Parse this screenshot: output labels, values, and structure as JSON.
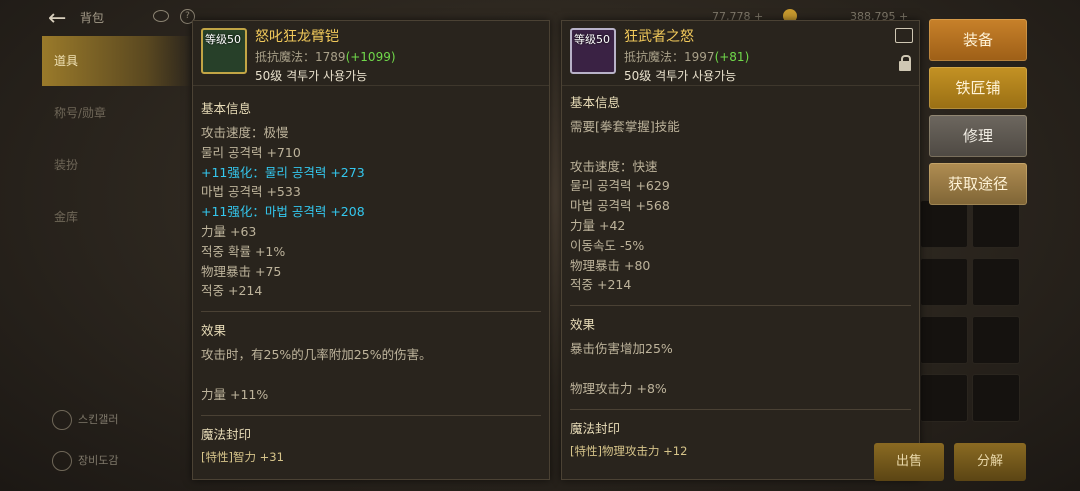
{
  "top": {
    "title": "背包",
    "currency_1": "77,778 +",
    "currency_2": "388,795 +"
  },
  "sidebar": {
    "items": [
      {
        "label": "道具"
      },
      {
        "label": "称号/勋章"
      },
      {
        "label": "装扮"
      },
      {
        "label": "金库"
      }
    ],
    "bottom_1": "스킨갤러",
    "bottom_2": "장비도감"
  },
  "left_item": {
    "level_badge": "等级50",
    "name": "怒叱狂龙臂铠",
    "magic_resist_label": "抵抗魔法：",
    "magic_resist_value": "1789",
    "magic_resist_bonus": "(+1099)",
    "requirement": "50级 격투가 사용가능",
    "basic_info_title": "基本信息",
    "stats": [
      "攻击速度：极慢",
      "물리 공격력 +710",
      "+11强化：물리 공격력 +273",
      "마법 공격력 +533",
      "+11强化：마법 공격력 +208",
      "力量 +63",
      "적중 확률 +1%",
      "物理暴击 +75",
      "적중 +214"
    ],
    "effect_title": "效果",
    "effect_lines": [
      "攻击时，有25%的几率附加25%的伤害。",
      "",
      "力量 +11%"
    ],
    "seal_title": "魔法封印",
    "seal_line": "[特性]智力 +31"
  },
  "right_item": {
    "level_badge": "等级50",
    "name": "狂武者之怒",
    "magic_resist_label": "抵抗魔法：",
    "magic_resist_value": "1997",
    "magic_resist_bonus": "(+81)",
    "requirement": "50级 격투가 사용가능",
    "basic_info_title": "基本信息",
    "stats": [
      "需要[拳套掌握]技能",
      "",
      "攻击速度：快速",
      "물리 공격력 +629",
      "마법 공격력 +568",
      "力量 +42",
      "이동속도 -5%",
      "物理暴击 +80",
      "적중 +214"
    ],
    "effect_title": "效果",
    "effect_lines": [
      "暴击伤害增加25%",
      "",
      "物理攻击力 +8%"
    ],
    "seal_title": "魔法封印",
    "seal_line": "[特性]物理攻击力 +12"
  },
  "buttons": {
    "equip": "装备",
    "smith": "铁匠铺",
    "repair": "修理",
    "source": "获取途径",
    "bottom_left": "出售",
    "bottom_right": "分解"
  }
}
